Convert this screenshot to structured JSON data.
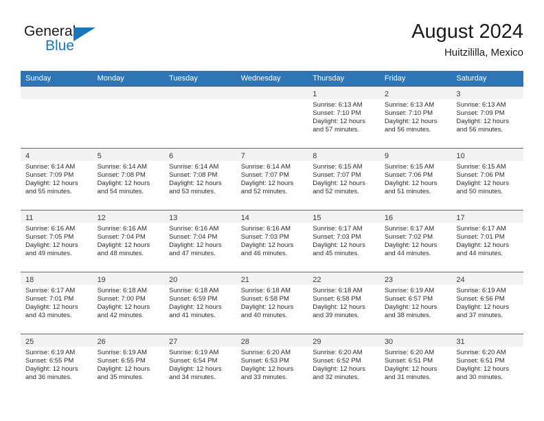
{
  "brand": {
    "name_part1": "General",
    "name_part2": "Blue",
    "flag_icon": "triangle-flag-icon"
  },
  "header": {
    "title": "August 2024",
    "subtitle": "Huitzililla, Mexico"
  },
  "colors": {
    "header_blue": "#2e75b6",
    "brand_blue": "#1b75bb",
    "daynum_band": "#f2f2f2",
    "text": "#2b2b2b"
  },
  "weekdays": [
    "Sunday",
    "Monday",
    "Tuesday",
    "Wednesday",
    "Thursday",
    "Friday",
    "Saturday"
  ],
  "labels": {
    "sunrise_prefix": "Sunrise:",
    "sunset_prefix": "Sunset:",
    "daylight_prefix": "Daylight:"
  },
  "weeks": [
    [
      {
        "day": "",
        "empty": true,
        "sunrise": "",
        "sunset": "",
        "daylight_line1": "",
        "daylight_line2": ""
      },
      {
        "day": "",
        "empty": true,
        "sunrise": "",
        "sunset": "",
        "daylight_line1": "",
        "daylight_line2": ""
      },
      {
        "day": "",
        "empty": true,
        "sunrise": "",
        "sunset": "",
        "daylight_line1": "",
        "daylight_line2": ""
      },
      {
        "day": "",
        "empty": true,
        "sunrise": "",
        "sunset": "",
        "daylight_line1": "",
        "daylight_line2": ""
      },
      {
        "day": "1",
        "empty": false,
        "sunrise": "Sunrise: 6:13 AM",
        "sunset": "Sunset: 7:10 PM",
        "daylight_line1": "Daylight: 12 hours",
        "daylight_line2": "and 57 minutes."
      },
      {
        "day": "2",
        "empty": false,
        "sunrise": "Sunrise: 6:13 AM",
        "sunset": "Sunset: 7:10 PM",
        "daylight_line1": "Daylight: 12 hours",
        "daylight_line2": "and 56 minutes."
      },
      {
        "day": "3",
        "empty": false,
        "sunrise": "Sunrise: 6:13 AM",
        "sunset": "Sunset: 7:09 PM",
        "daylight_line1": "Daylight: 12 hours",
        "daylight_line2": "and 56 minutes."
      }
    ],
    [
      {
        "day": "4",
        "empty": false,
        "sunrise": "Sunrise: 6:14 AM",
        "sunset": "Sunset: 7:09 PM",
        "daylight_line1": "Daylight: 12 hours",
        "daylight_line2": "and 55 minutes."
      },
      {
        "day": "5",
        "empty": false,
        "sunrise": "Sunrise: 6:14 AM",
        "sunset": "Sunset: 7:08 PM",
        "daylight_line1": "Daylight: 12 hours",
        "daylight_line2": "and 54 minutes."
      },
      {
        "day": "6",
        "empty": false,
        "sunrise": "Sunrise: 6:14 AM",
        "sunset": "Sunset: 7:08 PM",
        "daylight_line1": "Daylight: 12 hours",
        "daylight_line2": "and 53 minutes."
      },
      {
        "day": "7",
        "empty": false,
        "sunrise": "Sunrise: 6:14 AM",
        "sunset": "Sunset: 7:07 PM",
        "daylight_line1": "Daylight: 12 hours",
        "daylight_line2": "and 52 minutes."
      },
      {
        "day": "8",
        "empty": false,
        "sunrise": "Sunrise: 6:15 AM",
        "sunset": "Sunset: 7:07 PM",
        "daylight_line1": "Daylight: 12 hours",
        "daylight_line2": "and 52 minutes."
      },
      {
        "day": "9",
        "empty": false,
        "sunrise": "Sunrise: 6:15 AM",
        "sunset": "Sunset: 7:06 PM",
        "daylight_line1": "Daylight: 12 hours",
        "daylight_line2": "and 51 minutes."
      },
      {
        "day": "10",
        "empty": false,
        "sunrise": "Sunrise: 6:15 AM",
        "sunset": "Sunset: 7:06 PM",
        "daylight_line1": "Daylight: 12 hours",
        "daylight_line2": "and 50 minutes."
      }
    ],
    [
      {
        "day": "11",
        "empty": false,
        "sunrise": "Sunrise: 6:16 AM",
        "sunset": "Sunset: 7:05 PM",
        "daylight_line1": "Daylight: 12 hours",
        "daylight_line2": "and 49 minutes."
      },
      {
        "day": "12",
        "empty": false,
        "sunrise": "Sunrise: 6:16 AM",
        "sunset": "Sunset: 7:04 PM",
        "daylight_line1": "Daylight: 12 hours",
        "daylight_line2": "and 48 minutes."
      },
      {
        "day": "13",
        "empty": false,
        "sunrise": "Sunrise: 6:16 AM",
        "sunset": "Sunset: 7:04 PM",
        "daylight_line1": "Daylight: 12 hours",
        "daylight_line2": "and 47 minutes."
      },
      {
        "day": "14",
        "empty": false,
        "sunrise": "Sunrise: 6:16 AM",
        "sunset": "Sunset: 7:03 PM",
        "daylight_line1": "Daylight: 12 hours",
        "daylight_line2": "and 46 minutes."
      },
      {
        "day": "15",
        "empty": false,
        "sunrise": "Sunrise: 6:17 AM",
        "sunset": "Sunset: 7:03 PM",
        "daylight_line1": "Daylight: 12 hours",
        "daylight_line2": "and 45 minutes."
      },
      {
        "day": "16",
        "empty": false,
        "sunrise": "Sunrise: 6:17 AM",
        "sunset": "Sunset: 7:02 PM",
        "daylight_line1": "Daylight: 12 hours",
        "daylight_line2": "and 44 minutes."
      },
      {
        "day": "17",
        "empty": false,
        "sunrise": "Sunrise: 6:17 AM",
        "sunset": "Sunset: 7:01 PM",
        "daylight_line1": "Daylight: 12 hours",
        "daylight_line2": "and 44 minutes."
      }
    ],
    [
      {
        "day": "18",
        "empty": false,
        "sunrise": "Sunrise: 6:17 AM",
        "sunset": "Sunset: 7:01 PM",
        "daylight_line1": "Daylight: 12 hours",
        "daylight_line2": "and 43 minutes."
      },
      {
        "day": "19",
        "empty": false,
        "sunrise": "Sunrise: 6:18 AM",
        "sunset": "Sunset: 7:00 PM",
        "daylight_line1": "Daylight: 12 hours",
        "daylight_line2": "and 42 minutes."
      },
      {
        "day": "20",
        "empty": false,
        "sunrise": "Sunrise: 6:18 AM",
        "sunset": "Sunset: 6:59 PM",
        "daylight_line1": "Daylight: 12 hours",
        "daylight_line2": "and 41 minutes."
      },
      {
        "day": "21",
        "empty": false,
        "sunrise": "Sunrise: 6:18 AM",
        "sunset": "Sunset: 6:58 PM",
        "daylight_line1": "Daylight: 12 hours",
        "daylight_line2": "and 40 minutes."
      },
      {
        "day": "22",
        "empty": false,
        "sunrise": "Sunrise: 6:18 AM",
        "sunset": "Sunset: 6:58 PM",
        "daylight_line1": "Daylight: 12 hours",
        "daylight_line2": "and 39 minutes."
      },
      {
        "day": "23",
        "empty": false,
        "sunrise": "Sunrise: 6:19 AM",
        "sunset": "Sunset: 6:57 PM",
        "daylight_line1": "Daylight: 12 hours",
        "daylight_line2": "and 38 minutes."
      },
      {
        "day": "24",
        "empty": false,
        "sunrise": "Sunrise: 6:19 AM",
        "sunset": "Sunset: 6:56 PM",
        "daylight_line1": "Daylight: 12 hours",
        "daylight_line2": "and 37 minutes."
      }
    ],
    [
      {
        "day": "25",
        "empty": false,
        "sunrise": "Sunrise: 6:19 AM",
        "sunset": "Sunset: 6:55 PM",
        "daylight_line1": "Daylight: 12 hours",
        "daylight_line2": "and 36 minutes."
      },
      {
        "day": "26",
        "empty": false,
        "sunrise": "Sunrise: 6:19 AM",
        "sunset": "Sunset: 6:55 PM",
        "daylight_line1": "Daylight: 12 hours",
        "daylight_line2": "and 35 minutes."
      },
      {
        "day": "27",
        "empty": false,
        "sunrise": "Sunrise: 6:19 AM",
        "sunset": "Sunset: 6:54 PM",
        "daylight_line1": "Daylight: 12 hours",
        "daylight_line2": "and 34 minutes."
      },
      {
        "day": "28",
        "empty": false,
        "sunrise": "Sunrise: 6:20 AM",
        "sunset": "Sunset: 6:53 PM",
        "daylight_line1": "Daylight: 12 hours",
        "daylight_line2": "and 33 minutes."
      },
      {
        "day": "29",
        "empty": false,
        "sunrise": "Sunrise: 6:20 AM",
        "sunset": "Sunset: 6:52 PM",
        "daylight_line1": "Daylight: 12 hours",
        "daylight_line2": "and 32 minutes."
      },
      {
        "day": "30",
        "empty": false,
        "sunrise": "Sunrise: 6:20 AM",
        "sunset": "Sunset: 6:51 PM",
        "daylight_line1": "Daylight: 12 hours",
        "daylight_line2": "and 31 minutes."
      },
      {
        "day": "31",
        "empty": false,
        "sunrise": "Sunrise: 6:20 AM",
        "sunset": "Sunset: 6:51 PM",
        "daylight_line1": "Daylight: 12 hours",
        "daylight_line2": "and 30 minutes."
      }
    ]
  ]
}
